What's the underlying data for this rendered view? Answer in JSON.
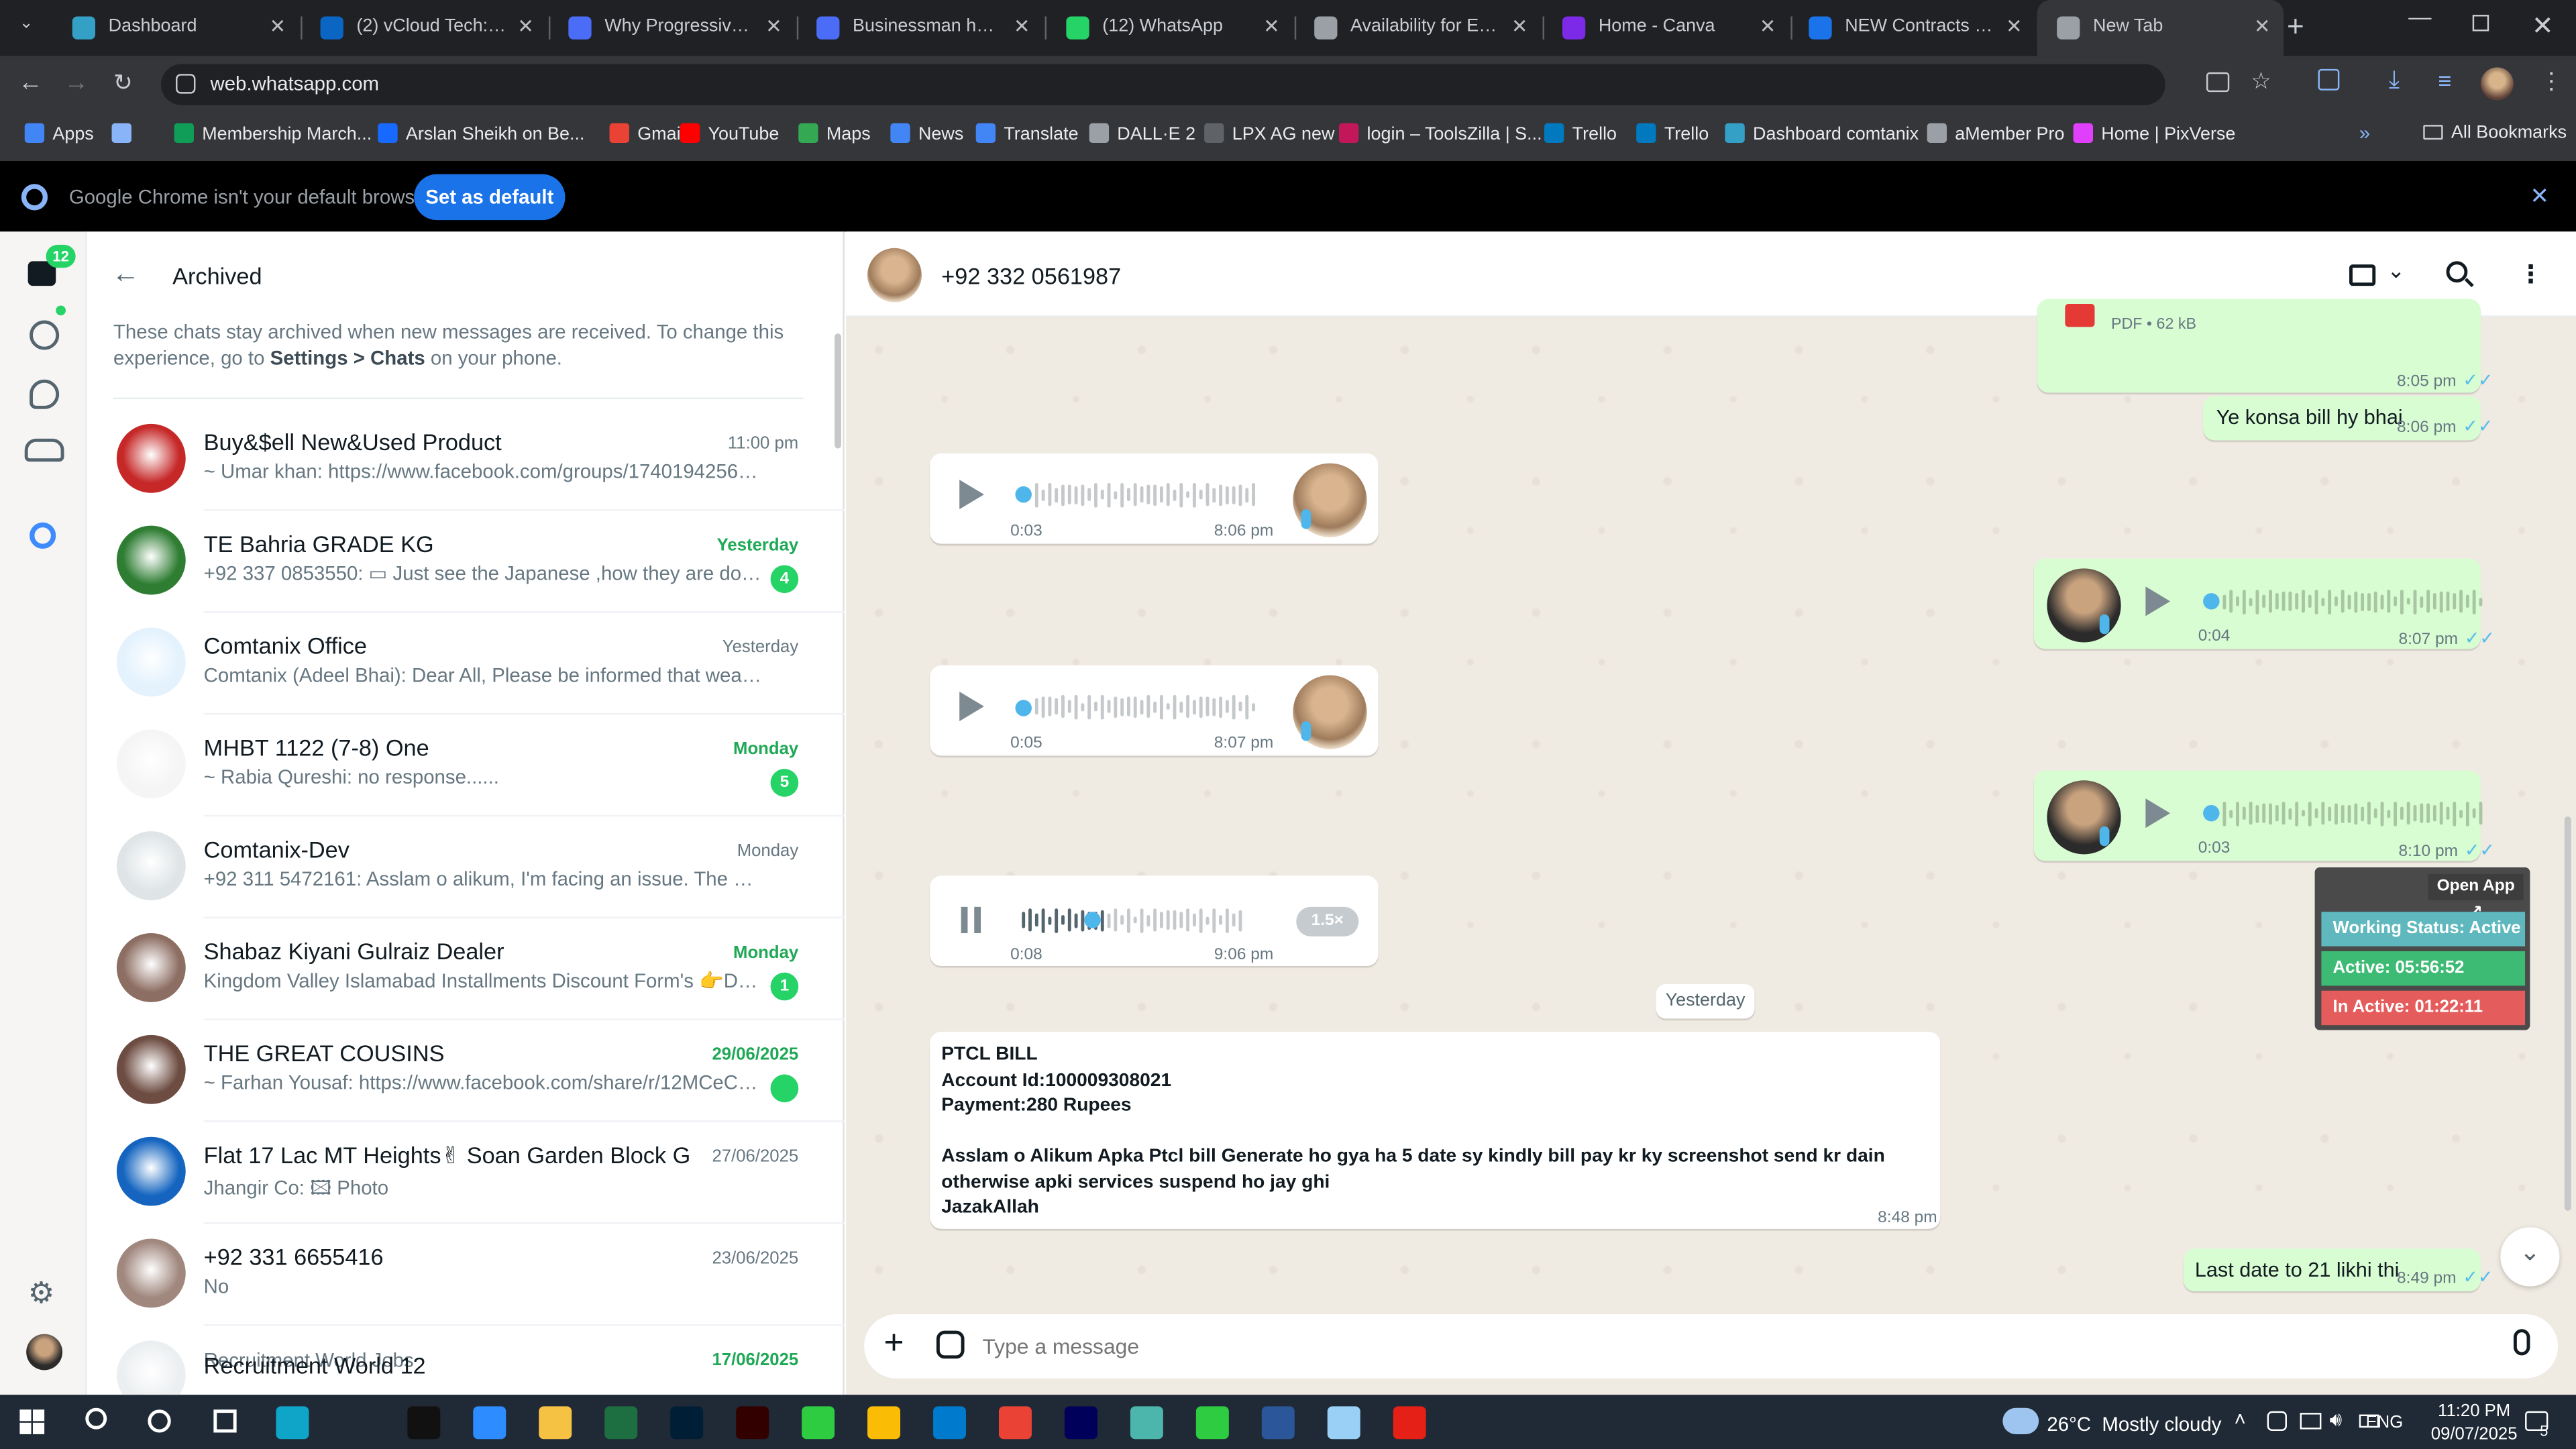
{
  "browser": {
    "tabs": [
      {
        "title": "Dashboard",
        "color": "#34a0c6"
      },
      {
        "title": "(2) vCloud Tech: Peop",
        "color": "#0a66c2"
      },
      {
        "title": "Why Progressive Web",
        "color": "#4a6cf7"
      },
      {
        "title": "Businessman holding",
        "color": "#4a6cf7"
      },
      {
        "title": "(12) WhatsApp",
        "color": "#25d366"
      },
      {
        "title": "Availability for EST sh",
        "color": "#9aa0a6"
      },
      {
        "title": "Home - Canva",
        "color": "#7d2ae8"
      },
      {
        "title": "NEW Contracts 01.p",
        "color": "#1a73e8"
      },
      {
        "title": "New Tab",
        "color": "#9aa0a6"
      }
    ],
    "url": "web.whatsapp.com",
    "bookmarks": [
      {
        "label": "Apps",
        "color": "#4285f4"
      },
      {
        "label": "",
        "color": "#8ab4f8"
      },
      {
        "label": "Membership March...",
        "color": "#0f9d58"
      },
      {
        "label": "Arslan Sheikh on Be...",
        "color": "#1769ff"
      },
      {
        "label": "Gmail",
        "color": "#ea4335"
      },
      {
        "label": "YouTube",
        "color": "#ff0000"
      },
      {
        "label": "Maps",
        "color": "#34a853"
      },
      {
        "label": "News",
        "color": "#4285f4"
      },
      {
        "label": "Translate",
        "color": "#4285f4"
      },
      {
        "label": "DALL·E 2",
        "color": "#9aa0a6"
      },
      {
        "label": "LPX AG new",
        "color": "#5f6368"
      },
      {
        "label": "login – ToolsZilla | S...",
        "color": "#c2185b"
      },
      {
        "label": "Trello",
        "color": "#0079bf"
      },
      {
        "label": "Trello",
        "color": "#0079bf"
      },
      {
        "label": "Dashboard comtanix",
        "color": "#34a0c6"
      },
      {
        "label": "aMember Pro",
        "color": "#9aa0a6"
      },
      {
        "label": "Home | PixVerse",
        "color": "#e040fb"
      }
    ],
    "all_bookmarks": "All Bookmarks",
    "infobar": {
      "text": "Google Chrome isn't your default browser",
      "button": "Set as default"
    }
  },
  "rail": {
    "unread_badge": "12"
  },
  "archived": {
    "title": "Archived",
    "notice_pre": "These chats stay archived when new messages are received. To change this experience, go to ",
    "notice_bold": "Settings > Chats",
    "notice_post": " on your phone.",
    "chats": [
      {
        "name": "Buy&$ell New&Used Product",
        "preview": "~ Umar khan: https://www.facebook.com/groups/1740194256590083...",
        "time": "11:00 pm",
        "time_green": false,
        "badge": "",
        "avatar": "#c62828"
      },
      {
        "name": "TE Bahria GRADE KG",
        "preview": "+92 337 0853550: ▭ Just see  the Japanese ,how they are doing ...",
        "time": "Yesterday",
        "time_green": true,
        "badge": "4",
        "avatar": "#2e7d32"
      },
      {
        "name": "Comtanix Office",
        "preview": "Comtanix (Adeel Bhai): Dear All,  Please be informed that wearing yo...",
        "time": "Yesterday",
        "time_green": false,
        "badge": "",
        "avatar": "#e3f2fd"
      },
      {
        "name": "MHBT 1122 (7-8) One",
        "preview": "~ Rabia Qureshi: no response......",
        "time": "Monday",
        "time_green": true,
        "badge": "5",
        "avatar": "#f5f5f5"
      },
      {
        "name": "Comtanix-Dev",
        "preview": "+92 311 5472161: Asslam o alikum, I'm facing an issue. The Peerwad...",
        "time": "Monday",
        "time_green": false,
        "badge": "",
        "avatar": "#dfe5e7"
      },
      {
        "name": "Shabaz Kiyani Gulraiz Dealer",
        "preview": "Kingdom Valley Islamabad Installments Discount Form's 👉Devel...",
        "time": "Monday",
        "time_green": true,
        "badge": "1",
        "avatar": "#8d6e63"
      },
      {
        "name": "THE GREAT COUSINS",
        "preview": "~ Farhan Yousaf: https://www.facebook.com/share/r/12MCeC7pY...",
        "time": "29/06/2025",
        "time_green": true,
        "badge": " ",
        "avatar": "#6d4c41"
      },
      {
        "name": "Flat 17 Lac MT Heights✌  Soan Garden Block G",
        "preview": "Jhangir Co: 🖾 Photo",
        "time": "27/06/2025",
        "time_green": false,
        "badge": "",
        "avatar": "#1565c0"
      },
      {
        "name": "+92 331 6655416",
        "preview": "No",
        "time": "23/06/2025",
        "time_green": false,
        "badge": "",
        "avatar": "#a1887f"
      },
      {
        "name": "Recruitment World 12",
        "preview": "",
        "time": "17/06/2025",
        "time_green": true,
        "badge": "",
        "avatar": "#eceff1"
      }
    ],
    "partial_label": "Recruitment World Jobs"
  },
  "conversation": {
    "contact": "+92 332 0561987",
    "pdf_size": "PDF • 62 kB",
    "messages": {
      "m1_time": "8:05 pm",
      "m2_text": "Ye konsa bill hy bhai",
      "m2_time": "8:06 pm",
      "v1_dur": "0:03",
      "v1_time": "8:06 pm",
      "v2_dur": "0:04",
      "v2_time": "8:07 pm",
      "v3_dur": "0:05",
      "v3_time": "8:07 pm",
      "v4_dur": "0:03",
      "v4_time": "8:10 pm",
      "v5_dur": "0:08",
      "v5_time": "9:06 pm",
      "v5_speed": "1.5×",
      "date_divider": "Yesterday",
      "bill_l1": "PTCL BILL",
      "bill_l2": "Account Id:100009308021",
      "bill_l3": "Payment:280 Rupees",
      "bill_l4": "Asslam o Alikum Apka Ptcl bill Generate ho gya ha 5 date sy kindly bill pay kr ky screenshot send kr dain otherwise apki services suspend ho jay ghi",
      "bill_l5": "JazakAllah",
      "bill_time": "8:48 pm",
      "last_text": "Last date to 21 likhi thi",
      "last_time": "8:49 pm"
    },
    "composer_placeholder": "Type a message"
  },
  "tracker": {
    "open_app": "Open App ↗",
    "working": "Working Status: Active",
    "active": "Active: 05:56:52",
    "inactive": "In Active: 01:22:11"
  },
  "taskbar": {
    "weather": "26°C  Mostly cloudy",
    "lang": "ENG",
    "time": "11:20 PM",
    "date": "09/07/2025",
    "notif": "5"
  }
}
